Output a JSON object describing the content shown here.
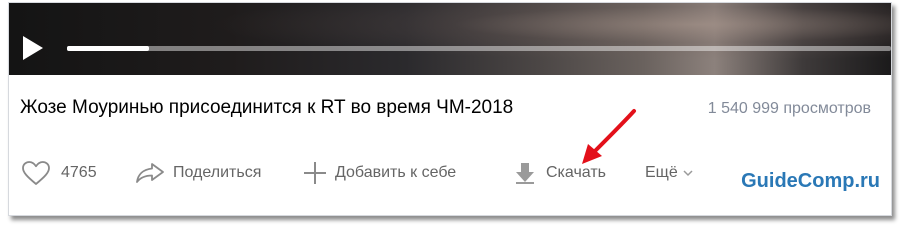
{
  "player": {
    "play_icon": "play-icon",
    "progress": 0.1
  },
  "video": {
    "title": "Жозе Моуринью присоединится к RT во время ЧМ-2018",
    "views": "1 540 999 просмотров"
  },
  "actions": {
    "like_icon": "heart-icon",
    "like_count": "4765",
    "share_icon": "share-arrow-icon",
    "share_label": "Поделиться",
    "add_icon": "plus-icon",
    "add_label": "Добавить к себе",
    "download_icon": "download-arrow-icon",
    "download_label": "Скачать",
    "more_label": "Ещё",
    "more_icon": "chevron-down-icon"
  },
  "annotation": {
    "arrow_color": "#e3101a"
  },
  "watermark": {
    "text": "GuideComp.ru",
    "color": "#2a78b6"
  }
}
